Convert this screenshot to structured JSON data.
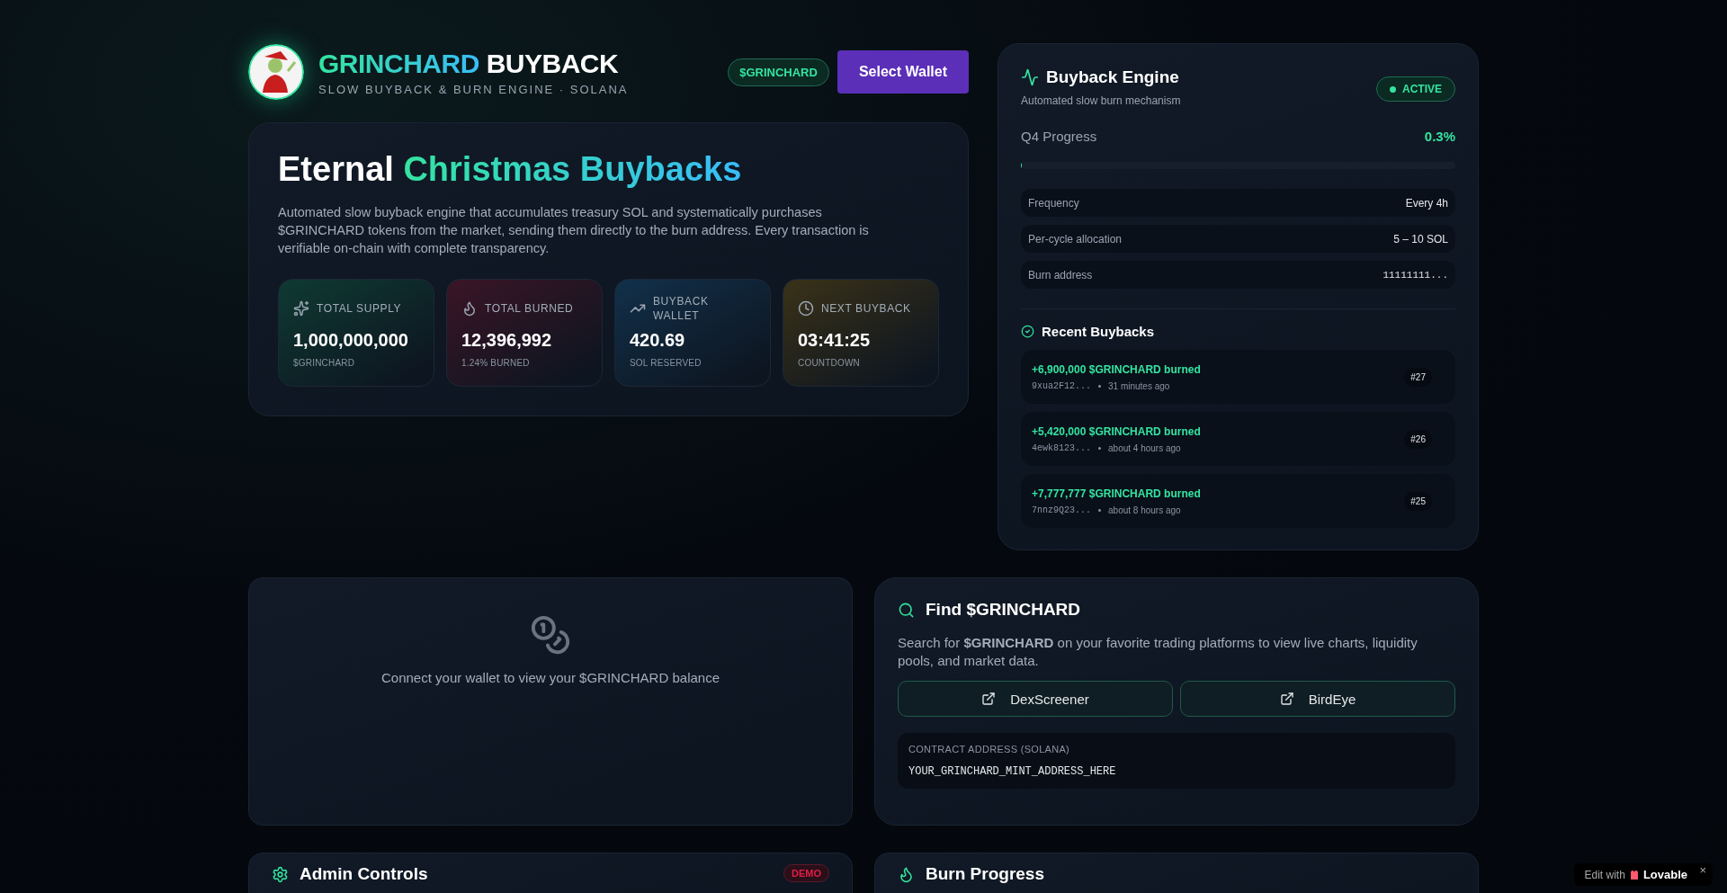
{
  "header": {
    "brand_highlight": "GRINCHARD",
    "brand_rest": "BUYBACK",
    "subtitle": "SLOW BUYBACK & BURN ENGINE · SOLANA",
    "token_badge": "$GRINCHARD",
    "wallet_button": "Select Wallet"
  },
  "hero": {
    "title_plain": "Eternal",
    "title_highlight": "Christmas Buybacks",
    "description": "Automated slow buyback engine that accumulates treasury SOL and systematically purchases $GRINCHARD tokens from the market, sending them directly to the burn address. Every transaction is verifiable on-chain with complete transparency.",
    "stats": [
      {
        "kind": "supply",
        "label": "TOTAL SUPPLY",
        "value": "1,000,000,000",
        "caption": "$GRINCHARD"
      },
      {
        "kind": "burned",
        "label": "TOTAL BURNED",
        "value": "12,396,992",
        "caption": "1.24% BURNED"
      },
      {
        "kind": "wallet",
        "label": "BUYBACK WALLET",
        "value": "420.69",
        "caption": "SOL RESERVED"
      },
      {
        "kind": "countdown",
        "label": "NEXT BUYBACK",
        "value": "03:41:25",
        "caption": "COUNTDOWN"
      }
    ]
  },
  "engine": {
    "title": "Buyback Engine",
    "subtitle": "Automated slow burn mechanism",
    "status": "ACTIVE",
    "active": true,
    "progress_label": "Q4 Progress",
    "progress_value": "0.3%",
    "level": 0.003,
    "details": [
      {
        "label": "Frequency",
        "value": "Every 4h",
        "mono": false
      },
      {
        "label": "Per-cycle allocation",
        "value": "5 – 10 SOL",
        "mono": false
      },
      {
        "label": "Burn address",
        "value": "11111111...",
        "mono": true
      }
    ],
    "recent_title": "Recent Buybacks",
    "recent": [
      {
        "amount": "+6,900,000 $GRINCHARD burned",
        "tx": "9xua2F12...",
        "time": "31 minutes ago",
        "number": "#27"
      },
      {
        "amount": "+5,420,000 $GRINCHARD burned",
        "tx": "4ewk8123...",
        "time": "about 4 hours ago",
        "number": "#26"
      },
      {
        "amount": "+7,777,777 $GRINCHARD burned",
        "tx": "7nnz9Q23...",
        "time": "about 8 hours ago",
        "number": "#25"
      }
    ]
  },
  "balance": {
    "message": "Connect your wallet to view your $GRINCHARD balance"
  },
  "find": {
    "title": "Find $GRINCHARD",
    "description": "Search for **$GRINCHARD** on your favorite trading platforms to view live charts, liquidity pools, and market data.",
    "links": [
      "DexScreener",
      "BirdEye"
    ],
    "contract_label": "CONTRACT ADDRESS (SOLANA)",
    "contract_value": "YOUR_GRINCHARD_MINT_ADDRESS_HERE"
  },
  "admin": {
    "title": "Admin Controls",
    "badge": "DEMO"
  },
  "burn_progress": {
    "title": "Burn Progress"
  },
  "lovable_badge": {
    "prefix": "Edit with",
    "brand": "Lovable",
    "close": "×"
  }
}
